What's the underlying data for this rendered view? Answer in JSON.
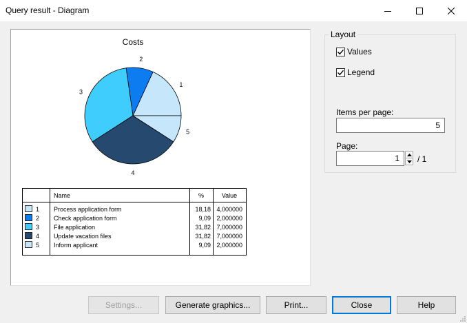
{
  "window": {
    "title": "Query result - Diagram"
  },
  "chart_data": {
    "type": "pie",
    "title": "Costs",
    "slices": [
      {
        "label": "1",
        "percent": 18.18,
        "value": 4.0,
        "color": "#c5e6fb"
      },
      {
        "label": "2",
        "percent": 9.09,
        "value": 2.0,
        "color": "#0e7cf1"
      },
      {
        "label": "3",
        "percent": 31.82,
        "value": 7.0,
        "color": "#3fcdfd"
      },
      {
        "label": "4",
        "percent": 31.82,
        "value": 7.0,
        "color": "#26496f"
      },
      {
        "label": "5",
        "percent": 9.09,
        "value": 2.0,
        "color": "#c5e6fb"
      }
    ],
    "table": {
      "headers": [
        "Name",
        "%",
        "Value"
      ],
      "rows": [
        {
          "num": "1",
          "name": "Process application form",
          "pct": "18,18",
          "value": "4,000000"
        },
        {
          "num": "2",
          "name": "Check application form",
          "pct": "9,09",
          "value": "2,000000"
        },
        {
          "num": "3",
          "name": "File application",
          "pct": "31,82",
          "value": "7,000000"
        },
        {
          "num": "4",
          "name": "Update vacation files",
          "pct": "31,82",
          "value": "7,000000"
        },
        {
          "num": "5",
          "name": "Inform applicant",
          "pct": "9,09",
          "value": "2,000000"
        }
      ]
    }
  },
  "layout": {
    "group_title": "Layout",
    "values_label": "Values",
    "values_checked": true,
    "legend_label": "Legend",
    "legend_checked": true,
    "items_per_page_label": "Items per page:",
    "items_per_page": "5",
    "page_label": "Page:",
    "page": "1",
    "page_total": "/ 1"
  },
  "buttons": {
    "settings": "Settings...",
    "generate": "Generate graphics...",
    "print": "Print...",
    "close": "Close",
    "help": "Help"
  }
}
